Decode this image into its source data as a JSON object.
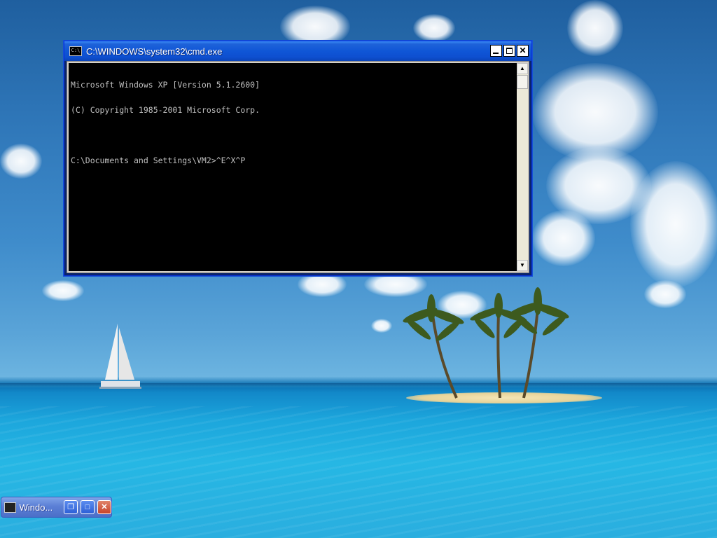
{
  "window": {
    "title": "C:\\WINDOWS\\system32\\cmd.exe",
    "icon": "cmd-icon",
    "icon_glyph": "C:\\",
    "buttons": {
      "minimize": "_",
      "maximize": "□",
      "close": "✕"
    },
    "console_lines": [
      "Microsoft Windows XP [Version 5.1.2600]",
      "(C) Copyright 1985-2001 Microsoft Corp.",
      "",
      "C:\\Documents and Settings\\VM2>^E^X^P"
    ],
    "scrollbar": {
      "up_arrow": "▲",
      "down_arrow": "▼"
    }
  },
  "minimized_window": {
    "title": "Windo...",
    "restore_glyph": "❐",
    "maximize_glyph": "□",
    "close_glyph": "✕"
  },
  "colors": {
    "titlebar": "#0f56d6",
    "console_bg": "#000000",
    "console_text": "#c0c0c0"
  }
}
